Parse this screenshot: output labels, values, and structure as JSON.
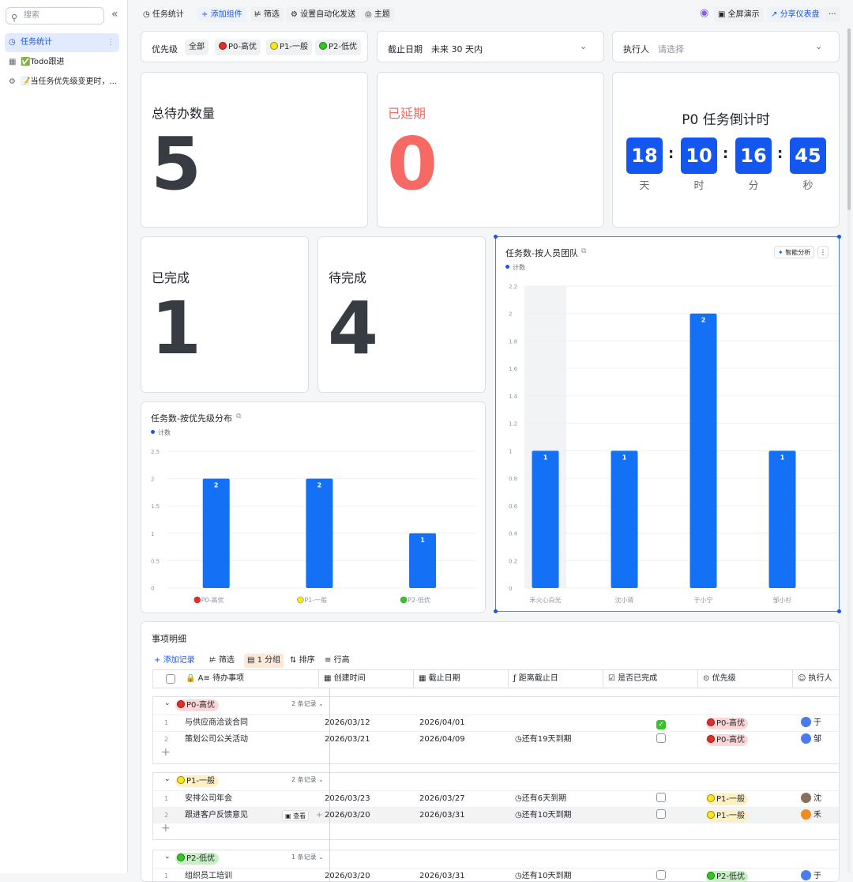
{
  "sidebar": {
    "search_placeholder": "搜索",
    "items": [
      {
        "label": "任务统计",
        "icon": "dashboard-icon"
      },
      {
        "label": "✅Todo跟进",
        "icon": "table-icon"
      },
      {
        "label": "📝当任务优先级变更时，...",
        "icon": "workflow-icon"
      }
    ]
  },
  "toolbar": {
    "title": "任务统计",
    "add_widget": "添加组件",
    "filter": "筛选",
    "auto_send": "设置自动化发送",
    "theme": "主题",
    "fullscreen": "全屏演示",
    "share": "分享仪表盘"
  },
  "filters": {
    "priority_label": "优先级",
    "priority_options": [
      {
        "label": "全部",
        "color": ""
      },
      {
        "label": "P0-高优",
        "color": "#e22e28"
      },
      {
        "label": "P1-一般",
        "color": "#f8e71c"
      },
      {
        "label": "P2-低优",
        "color": "#34c724"
      }
    ],
    "deadline_label": "截止日期",
    "deadline_value": "未来 30 天内",
    "assignee_label": "执行人",
    "assignee_placeholder": "请选择"
  },
  "kpis": {
    "total": {
      "label": "总待办数量",
      "value": "5"
    },
    "overdue": {
      "label": "已延期",
      "value": "0",
      "color": "#f76964"
    },
    "done": {
      "label": "已完成",
      "value": "1"
    },
    "pending": {
      "label": "待完成",
      "value": "4"
    }
  },
  "countdown": {
    "title": "P0 任务倒计时",
    "days": "18",
    "hours": "10",
    "minutes": "16",
    "seconds": "45",
    "units": [
      "天",
      "时",
      "分",
      "秒"
    ]
  },
  "chart_data": [
    {
      "type": "bar",
      "title": "任务数-按优先级分布",
      "legend": "计数",
      "categories": [
        "P0-高优",
        "P1-一般",
        "P2-低优"
      ],
      "category_colors": [
        "#e22e28",
        "#f8e71c",
        "#34c724"
      ],
      "values": [
        2,
        2,
        1
      ],
      "yticks": [
        "0",
        "0.5",
        "1",
        "1.5",
        "2",
        "2.5"
      ],
      "ylim": [
        0,
        2.5
      ],
      "color": "#1470f5"
    },
    {
      "type": "bar",
      "title": "任务数-按人员团队",
      "legend": "计数",
      "analyze_label": "智能分析",
      "categories": [
        "禾火心白光",
        "沈小蒋",
        "于小宁",
        "邹小杉"
      ],
      "values": [
        1,
        1,
        2,
        1
      ],
      "yticks": [
        "0",
        "0.2",
        "0.4",
        "0.6",
        "0.8",
        "1",
        "1.2",
        "1.4",
        "1.6",
        "1.8",
        "2",
        "2.2"
      ],
      "ylim": [
        0,
        2.2
      ],
      "color": "#1470f5"
    }
  ],
  "table": {
    "title": "事项明细",
    "tools": {
      "add": "添加记录",
      "filter": "筛选",
      "group": "1 分组",
      "sort": "排序",
      "row_height": "行高"
    },
    "columns": [
      "待办事项",
      "创建时间",
      "截止日期",
      "距离截止日",
      "是否已完成",
      "优先级",
      "执行人"
    ],
    "view_label": "查看",
    "groups": [
      {
        "label": "P0-高优",
        "count": "2 条记录",
        "color": "#e22e28",
        "bg": "#fdd7d6",
        "rows": [
          {
            "idx": "1",
            "task": "与供应商洽谈合同",
            "created": "2026/03/12",
            "due": "2026/04/01",
            "remain": "",
            "done": true,
            "priority": "P0-高优",
            "assignee": "于"
          },
          {
            "idx": "2",
            "task": "策划公司公关活动",
            "created": "2026/03/21",
            "due": "2026/04/09",
            "remain": "还有19天到期",
            "done": false,
            "priority": "P0-高优",
            "assignee": "邹"
          }
        ]
      },
      {
        "label": "P1-一般",
        "count": "2 条记录",
        "color": "#f8e71c",
        "bg": "#fdf0c4",
        "rows": [
          {
            "idx": "1",
            "task": "安排公司年会",
            "created": "2026/03/23",
            "due": "2026/03/27",
            "remain": "还有6天到期",
            "done": false,
            "priority": "P1-一般",
            "assignee": "沈"
          },
          {
            "idx": "2",
            "task": "跟进客户反馈意见",
            "created": "2026/03/20",
            "due": "2026/03/31",
            "remain": "还有10天到期",
            "done": false,
            "priority": "P1-一般",
            "assignee": "禾"
          }
        ]
      },
      {
        "label": "P2-低优",
        "count": "1 条记录",
        "color": "#34c724",
        "bg": "#c9efc4",
        "rows": [
          {
            "idx": "1",
            "task": "组织员工培训",
            "created": "2026/03/20",
            "due": "2026/03/31",
            "remain": "还有10天到期",
            "done": false,
            "priority": "P2-低优",
            "assignee": "于"
          }
        ]
      }
    ]
  }
}
